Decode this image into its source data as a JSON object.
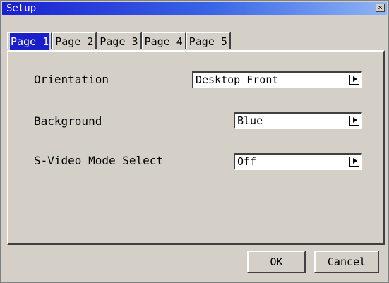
{
  "window": {
    "title": "Setup",
    "close_glyph": "×"
  },
  "tabs": [
    {
      "label": "Page 1",
      "active": true
    },
    {
      "label": "Page 2",
      "active": false
    },
    {
      "label": "Page 3",
      "active": false
    },
    {
      "label": "Page 4",
      "active": false
    },
    {
      "label": "Page 5",
      "active": false
    }
  ],
  "settings": {
    "orientation": {
      "label": "Orientation",
      "value": "Desktop Front"
    },
    "background": {
      "label": "Background",
      "value": "Blue"
    },
    "svideo": {
      "label": "S-Video Mode Select",
      "value": "Off"
    }
  },
  "buttons": {
    "ok": "OK",
    "cancel": "Cancel"
  },
  "colors": {
    "titlebar_start": "#1a1fd0",
    "titlebar_end": "#8fb4f4",
    "face": "#d4d0c8",
    "active_tab": "#1a1fcc"
  }
}
